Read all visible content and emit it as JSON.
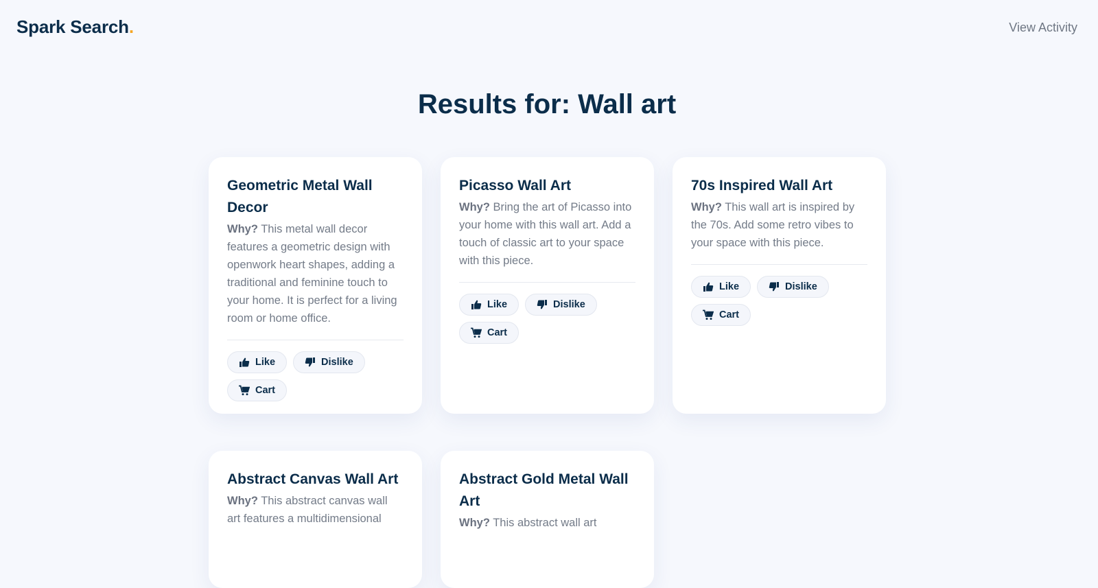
{
  "header": {
    "brand": "Spark Search",
    "brand_dot": ".",
    "view_activity": "View Activity"
  },
  "results_title": "Results for: Wall art",
  "why_label": "Why?",
  "actions": {
    "like": "Like",
    "dislike": "Dislike",
    "cart": "Cart"
  },
  "products": [
    {
      "title": "Geometric Metal Wall Decor",
      "why": "This metal wall decor features a geometric design with openwork heart shapes, adding a traditional and feminine touch to your home. It is perfect for a living room or home office."
    },
    {
      "title": "Picasso Wall Art",
      "why": "Bring the art of Picasso into your home with this wall art. Add a touch of classic art to your space with this piece."
    },
    {
      "title": "70s Inspired Wall Art",
      "why": "This wall art is inspired by the 70s. Add some retro vibes to your space with this piece."
    },
    {
      "title": "Abstract Canvas Wall Art",
      "why": "This abstract canvas wall art features a multidimensional"
    },
    {
      "title": "Abstract Gold Metal Wall Art",
      "why": "This abstract wall art"
    }
  ],
  "colors": {
    "background": "#f6f8fd",
    "primary_text": "#0b2d4a",
    "accent_dot": "#f5a623",
    "muted_text": "#737b88"
  },
  "icons": {
    "like": "thumbs-up-icon",
    "dislike": "thumbs-down-icon",
    "cart": "shopping-cart-icon"
  }
}
